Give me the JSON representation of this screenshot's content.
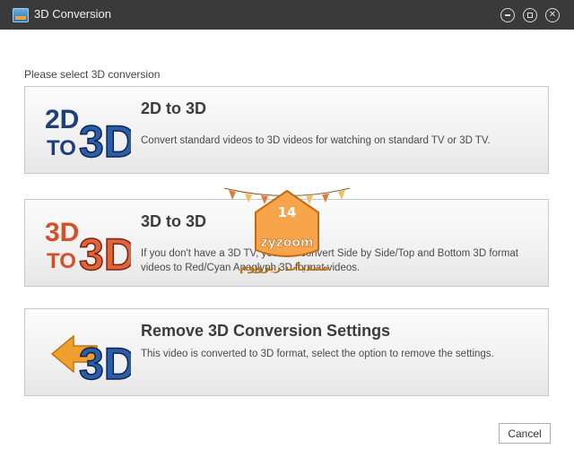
{
  "window": {
    "title": "3D Conversion",
    "controls": [
      "minimize",
      "maximize",
      "close"
    ]
  },
  "main": {
    "prompt": "Please select 3D conversion",
    "options": [
      {
        "title": "2D to 3D",
        "description": "Convert standard videos to 3D videos for watching on standard TV or 3D TV.",
        "icon": "2d-to-3d-icon",
        "icon_text": [
          "2D",
          "TO",
          "3D"
        ]
      },
      {
        "title": "3D to 3D",
        "description": "If you don't have a 3D TV, you can convert Side by Side/Top and Bottom 3D format videos to Red/Cyan Anaglyph 3D format videos.",
        "icon": "3d-to-3d-icon",
        "icon_text": [
          "3D",
          "TO",
          "3D"
        ]
      },
      {
        "title": "Remove 3D Conversion Settings",
        "description": "This video is converted to 3D format, select the option to remove the settings.",
        "icon": "remove-3d-icon",
        "icon_text": [
          "3D"
        ]
      }
    ],
    "cancel_label": "Cancel"
  },
  "watermark": {
    "text": "zyzoom",
    "arabic_text": "منتديات زيزووم",
    "badge": "14"
  },
  "colors": {
    "titlebar": "#3a3a3a",
    "icon_blue": "#1e3f7a",
    "icon_orange": "#d2502a",
    "arrow_orange": "#f0a030"
  }
}
